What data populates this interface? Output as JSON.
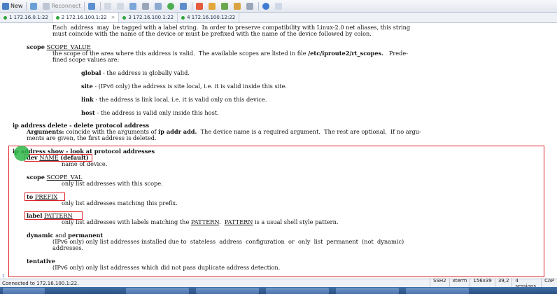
{
  "toolbar": {
    "new_label": "New",
    "reconnect_label": "Reconnect"
  },
  "tabs": [
    {
      "label": "1 172.16.0.1:22",
      "active": false
    },
    {
      "label": "2 172.16.100.1:22",
      "active": true
    },
    {
      "label": "3 172.16.100.1:22",
      "active": false
    },
    {
      "label": "4 172.16.100.12:22",
      "active": false
    }
  ],
  "terminal": {
    "l1": "Each  address  may  be tagged with a label string.  In order to preserve compatibility with Linux-2.0 net aliases, this string",
    "l2": "must coincide with the name of the device or must be prefixed with the name of the device followed by colon.",
    "scope_kw": "scope",
    "scope_val": "SCOPE_VALUE",
    "l4a": "the scope of the area where this address is valid.  The available scopes are listed in file ",
    "l4b": "/etc/iproute2/rt_scopes.",
    "l4c": "   Prede-",
    "l5": "fined scope values are:",
    "g_kw": "global",
    "g_text": " - the address is globally valid.",
    "s_kw": "site",
    "s_text": " - (IPv6 only) the address is site local, i.e. it is valid inside this site.",
    "k_kw": "link",
    "k_text": " - the address is link local, i.e. it is valid only on this device.",
    "h_kw": "host",
    "h_text": " - the address is valid only inside this host.",
    "del_title": "ip address delete - delete protocol address",
    "args_kw": "Arguments:",
    "args_text1": " coincide with the arguments of ",
    "args_kw2": "ip addr add.",
    "args_text2": "  The device name is a required argument.  The rest are optional.  If no argu-",
    "args_l2": "ments are given, the first address is deleted.",
    "show_title": "ip address show - look at protocol addresses",
    "dev_kw": "dev",
    "dev_val": "NAME",
    "dev_def": "(default)",
    "dev_desc": "name of device.",
    "sc_kw": "scope",
    "sc_val": "SCOPE_VAL",
    "sc_desc": "only list addresses with this scope.",
    "to_kw": "to",
    "to_val": "PREFIX",
    "to_desc": "only list addresses matching this prefix.",
    "lb_kw": "label",
    "lb_val": "PATTERN",
    "lb_desc_a": "only list addresses with labels matching the ",
    "lb_desc_b": "PATTERN",
    "lb_desc_c": ".  ",
    "lb_desc_d": "PATTERN",
    "lb_desc_e": " is a usual shell style pattern.",
    "dyn_kw": "dynamic",
    "dyn_and": " and ",
    "perm_kw": "permanent",
    "dyn_l1": "(IPv6 only) only list addresses installed due to  stateless  address  configuration  or  only  list  permanent  (not  dynamic)",
    "dyn_l2": "addresses.",
    "tent_kw": "tentative",
    "tent_desc": "(IPv6 only) only list addresses which did not pass duplicate address detection.",
    "prompt": ":"
  },
  "status": {
    "connection": "Connected to 172.16.100.1:22.",
    "proto": "SSH2",
    "term": "xterm",
    "size": "156x39",
    "pos": "39,2",
    "sessions": "4 sessions",
    "caps": "CAP"
  },
  "colors": {
    "highlight_box": "#e0242a",
    "active_dot": "#2ea43a"
  }
}
